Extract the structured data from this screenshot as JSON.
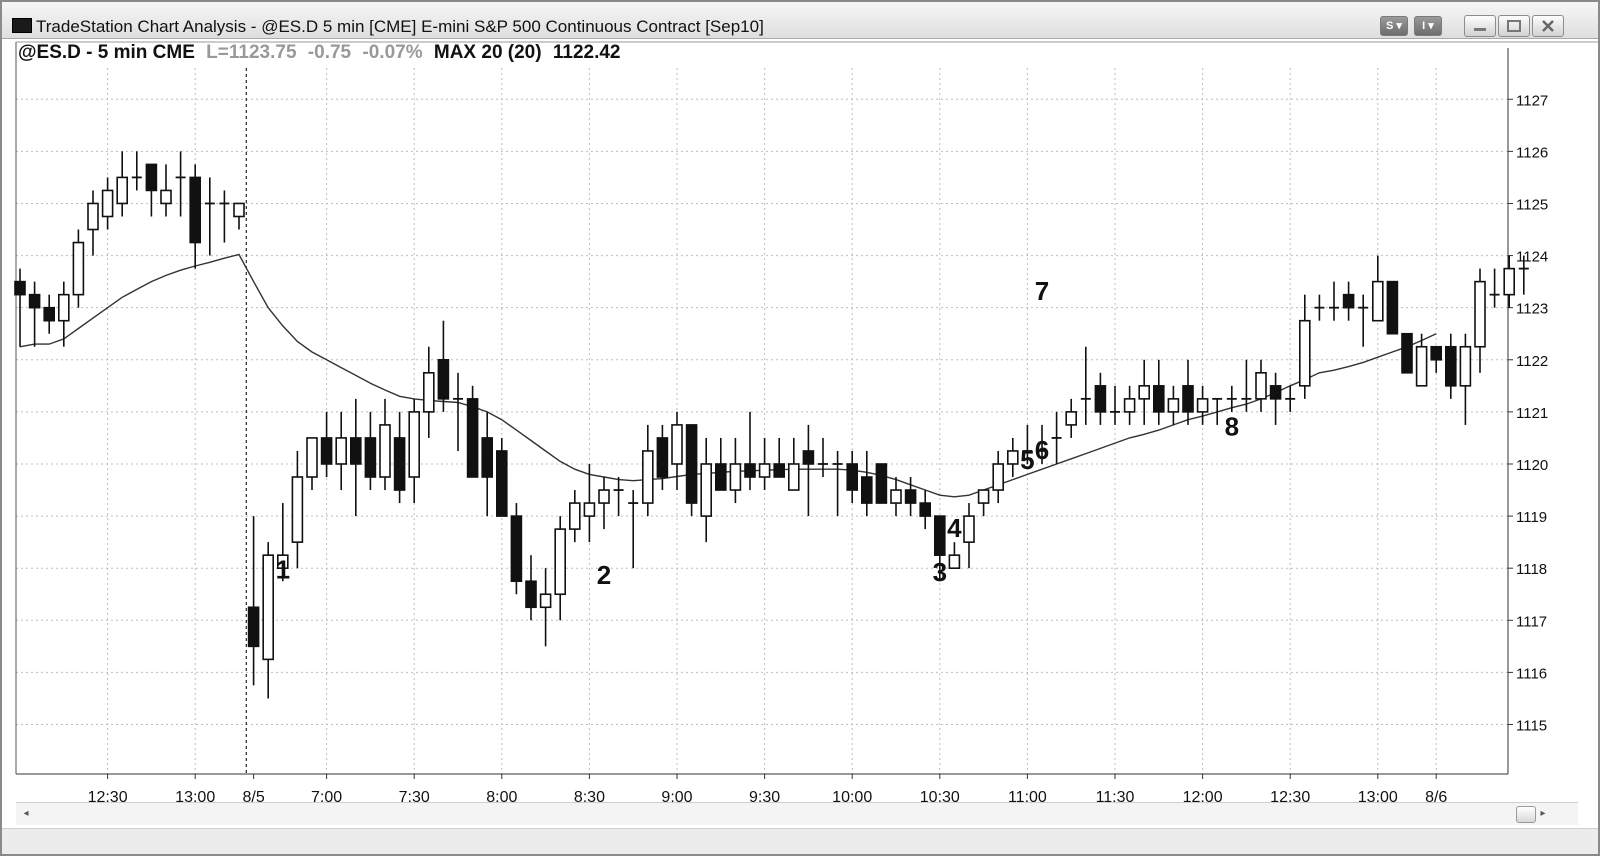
{
  "window": {
    "title": "TradeStation Chart Analysis - @ES.D 5 min [CME] E-mini S&P 500 Continuous Contract [Sep10]",
    "btn_s": "S",
    "btn_i": "I"
  },
  "header": {
    "symbol": "@ES.D - 5 min CME",
    "last": "L=1123.75",
    "change": "-0.75",
    "pct": "-0.07%",
    "study": "MAX 20 (20)",
    "study_value": "1122.42"
  },
  "colors": {
    "up_fill": "#ffffff",
    "down_fill": "#111111",
    "grid": "#bdbdbd",
    "ma_line": "#333333"
  },
  "chart_data": {
    "type": "candlestick",
    "ylim": [
      1114.05,
      1127.6
    ],
    "y_ticks": [
      1115,
      1116,
      1117,
      1118,
      1119,
      1120,
      1121,
      1122,
      1123,
      1124,
      1125,
      1126,
      1127
    ],
    "x_labels": [
      {
        "label": "12:30",
        "bar": 6
      },
      {
        "label": "13:00",
        "bar": 12
      },
      {
        "label": "8/5",
        "bar": 16
      },
      {
        "label": "7:00",
        "bar": 21
      },
      {
        "label": "7:30",
        "bar": 27
      },
      {
        "label": "8:00",
        "bar": 33
      },
      {
        "label": "8:30",
        "bar": 39
      },
      {
        "label": "9:00",
        "bar": 45
      },
      {
        "label": "9:30",
        "bar": 51
      },
      {
        "label": "10:00",
        "bar": 57
      },
      {
        "label": "10:30",
        "bar": 63
      },
      {
        "label": "11:00",
        "bar": 69
      },
      {
        "label": "11:30",
        "bar": 75
      },
      {
        "label": "12:00",
        "bar": 81
      },
      {
        "label": "12:30",
        "bar": 87
      },
      {
        "label": "13:00",
        "bar": 93
      },
      {
        "label": "8/6",
        "bar": 97
      }
    ],
    "session_break_bar": 16,
    "bars": [
      {
        "o": 1123.5,
        "h": 1123.75,
        "l": 1122.25,
        "c": 1123.25
      },
      {
        "o": 1123.25,
        "h": 1123.5,
        "l": 1122.25,
        "c": 1123.0
      },
      {
        "o": 1123.0,
        "h": 1123.25,
        "l": 1122.5,
        "c": 1122.75
      },
      {
        "o": 1122.75,
        "h": 1123.5,
        "l": 1122.25,
        "c": 1123.25
      },
      {
        "o": 1123.25,
        "h": 1124.5,
        "l": 1123.0,
        "c": 1124.25
      },
      {
        "o": 1124.5,
        "h": 1125.25,
        "l": 1124.0,
        "c": 1125.0
      },
      {
        "o": 1124.75,
        "h": 1125.5,
        "l": 1124.5,
        "c": 1125.25
      },
      {
        "o": 1125.0,
        "h": 1126.0,
        "l": 1124.75,
        "c": 1125.5
      },
      {
        "o": 1125.5,
        "h": 1126.0,
        "l": 1125.25,
        "c": 1125.5
      },
      {
        "o": 1125.75,
        "h": 1125.75,
        "l": 1124.75,
        "c": 1125.25
      },
      {
        "o": 1125.0,
        "h": 1125.75,
        "l": 1124.75,
        "c": 1125.25
      },
      {
        "o": 1125.5,
        "h": 1126.0,
        "l": 1124.75,
        "c": 1125.5
      },
      {
        "o": 1125.5,
        "h": 1125.75,
        "l": 1123.75,
        "c": 1124.25
      },
      {
        "o": 1125.0,
        "h": 1125.5,
        "l": 1124.0,
        "c": 1125.0
      },
      {
        "o": 1125.0,
        "h": 1125.25,
        "l": 1124.25,
        "c": 1125.0
      },
      {
        "o": 1124.75,
        "h": 1125.0,
        "l": 1124.5,
        "c": 1125.0
      },
      {
        "o": 1117.25,
        "h": 1119.0,
        "l": 1115.75,
        "c": 1116.5
      },
      {
        "o": 1116.25,
        "h": 1118.5,
        "l": 1115.5,
        "c": 1118.25
      },
      {
        "o": 1118.0,
        "h": 1119.25,
        "l": 1117.75,
        "c": 1118.25
      },
      {
        "o": 1118.5,
        "h": 1120.25,
        "l": 1118.0,
        "c": 1119.75
      },
      {
        "o": 1119.75,
        "h": 1120.5,
        "l": 1119.5,
        "c": 1120.5
      },
      {
        "o": 1120.5,
        "h": 1121.0,
        "l": 1119.75,
        "c": 1120.0
      },
      {
        "o": 1120.0,
        "h": 1121.0,
        "l": 1119.5,
        "c": 1120.5
      },
      {
        "o": 1120.5,
        "h": 1121.25,
        "l": 1119.0,
        "c": 1120.0
      },
      {
        "o": 1120.5,
        "h": 1121.0,
        "l": 1119.5,
        "c": 1119.75
      },
      {
        "o": 1119.75,
        "h": 1121.25,
        "l": 1119.5,
        "c": 1120.75
      },
      {
        "o": 1120.5,
        "h": 1121.0,
        "l": 1119.25,
        "c": 1119.5
      },
      {
        "o": 1119.75,
        "h": 1121.25,
        "l": 1119.25,
        "c": 1121.0
      },
      {
        "o": 1121.0,
        "h": 1122.25,
        "l": 1120.5,
        "c": 1121.75
      },
      {
        "o": 1122.0,
        "h": 1122.75,
        "l": 1121.0,
        "c": 1121.25
      },
      {
        "o": 1121.25,
        "h": 1121.75,
        "l": 1120.25,
        "c": 1121.25
      },
      {
        "o": 1121.25,
        "h": 1121.5,
        "l": 1119.75,
        "c": 1119.75
      },
      {
        "o": 1120.5,
        "h": 1121.0,
        "l": 1119.0,
        "c": 1119.75
      },
      {
        "o": 1120.25,
        "h": 1120.5,
        "l": 1119.0,
        "c": 1119.0
      },
      {
        "o": 1119.0,
        "h": 1119.25,
        "l": 1117.5,
        "c": 1117.75
      },
      {
        "o": 1117.75,
        "h": 1118.25,
        "l": 1117.0,
        "c": 1117.25
      },
      {
        "o": 1117.25,
        "h": 1118.0,
        "l": 1116.5,
        "c": 1117.5
      },
      {
        "o": 1117.5,
        "h": 1119.0,
        "l": 1117.0,
        "c": 1118.75
      },
      {
        "o": 1118.75,
        "h": 1119.5,
        "l": 1118.5,
        "c": 1119.25
      },
      {
        "o": 1119.0,
        "h": 1120.0,
        "l": 1118.5,
        "c": 1119.25
      },
      {
        "o": 1119.25,
        "h": 1119.75,
        "l": 1118.75,
        "c": 1119.5
      },
      {
        "o": 1119.5,
        "h": 1119.75,
        "l": 1119.0,
        "c": 1119.5
      },
      {
        "o": 1119.25,
        "h": 1119.5,
        "l": 1118.0,
        "c": 1119.25
      },
      {
        "o": 1119.25,
        "h": 1120.75,
        "l": 1119.0,
        "c": 1120.25
      },
      {
        "o": 1120.5,
        "h": 1120.75,
        "l": 1119.5,
        "c": 1119.75
      },
      {
        "o": 1120.0,
        "h": 1121.0,
        "l": 1119.5,
        "c": 1120.75
      },
      {
        "o": 1120.75,
        "h": 1120.75,
        "l": 1119.0,
        "c": 1119.25
      },
      {
        "o": 1119.0,
        "h": 1120.5,
        "l": 1118.5,
        "c": 1120.0
      },
      {
        "o": 1120.0,
        "h": 1120.5,
        "l": 1119.5,
        "c": 1119.5
      },
      {
        "o": 1119.5,
        "h": 1120.5,
        "l": 1119.25,
        "c": 1120.0
      },
      {
        "o": 1120.0,
        "h": 1121.0,
        "l": 1119.5,
        "c": 1119.75
      },
      {
        "o": 1119.75,
        "h": 1120.5,
        "l": 1119.5,
        "c": 1120.0
      },
      {
        "o": 1120.0,
        "h": 1120.5,
        "l": 1119.75,
        "c": 1119.75
      },
      {
        "o": 1119.5,
        "h": 1120.5,
        "l": 1119.5,
        "c": 1120.0
      },
      {
        "o": 1120.25,
        "h": 1120.75,
        "l": 1119.0,
        "c": 1120.0
      },
      {
        "o": 1120.0,
        "h": 1120.5,
        "l": 1119.75,
        "c": 1120.0
      },
      {
        "o": 1120.0,
        "h": 1120.25,
        "l": 1119.0,
        "c": 1120.0
      },
      {
        "o": 1120.0,
        "h": 1120.25,
        "l": 1119.25,
        "c": 1119.5
      },
      {
        "o": 1119.75,
        "h": 1120.25,
        "l": 1119.0,
        "c": 1119.25
      },
      {
        "o": 1120.0,
        "h": 1120.0,
        "l": 1119.25,
        "c": 1119.25
      },
      {
        "o": 1119.25,
        "h": 1119.75,
        "l": 1119.0,
        "c": 1119.5
      },
      {
        "o": 1119.5,
        "h": 1119.75,
        "l": 1119.0,
        "c": 1119.25
      },
      {
        "o": 1119.25,
        "h": 1119.5,
        "l": 1118.75,
        "c": 1119.0
      },
      {
        "o": 1119.0,
        "h": 1119.0,
        "l": 1117.75,
        "c": 1118.25
      },
      {
        "o": 1118.0,
        "h": 1118.5,
        "l": 1118.0,
        "c": 1118.25
      },
      {
        "o": 1118.5,
        "h": 1119.25,
        "l": 1118.0,
        "c": 1119.0
      },
      {
        "o": 1119.25,
        "h": 1119.5,
        "l": 1119.0,
        "c": 1119.5
      },
      {
        "o": 1119.5,
        "h": 1120.25,
        "l": 1119.25,
        "c": 1120.0
      },
      {
        "o": 1120.0,
        "h": 1120.5,
        "l": 1119.75,
        "c": 1120.25
      },
      {
        "o": 1120.25,
        "h": 1120.75,
        "l": 1120.0,
        "c": 1120.25
      },
      {
        "o": 1120.25,
        "h": 1120.75,
        "l": 1120.0,
        "c": 1120.25
      },
      {
        "o": 1120.5,
        "h": 1121.0,
        "l": 1120.0,
        "c": 1120.5
      },
      {
        "o": 1120.75,
        "h": 1121.25,
        "l": 1120.5,
        "c": 1121.0
      },
      {
        "o": 1121.25,
        "h": 1122.25,
        "l": 1120.75,
        "c": 1121.25
      },
      {
        "o": 1121.5,
        "h": 1121.75,
        "l": 1120.75,
        "c": 1121.0
      },
      {
        "o": 1121.0,
        "h": 1121.5,
        "l": 1120.75,
        "c": 1121.0
      },
      {
        "o": 1121.0,
        "h": 1121.5,
        "l": 1120.75,
        "c": 1121.25
      },
      {
        "o": 1121.25,
        "h": 1122.0,
        "l": 1120.75,
        "c": 1121.5
      },
      {
        "o": 1121.5,
        "h": 1122.0,
        "l": 1120.75,
        "c": 1121.0
      },
      {
        "o": 1121.0,
        "h": 1121.5,
        "l": 1120.75,
        "c": 1121.25
      },
      {
        "o": 1121.5,
        "h": 1122.0,
        "l": 1120.75,
        "c": 1121.0
      },
      {
        "o": 1121.0,
        "h": 1121.5,
        "l": 1120.75,
        "c": 1121.25
      },
      {
        "o": 1121.25,
        "h": 1121.25,
        "l": 1120.75,
        "c": 1121.25
      },
      {
        "o": 1121.25,
        "h": 1121.5,
        "l": 1121.0,
        "c": 1121.25
      },
      {
        "o": 1121.25,
        "h": 1122.0,
        "l": 1121.0,
        "c": 1121.25
      },
      {
        "o": 1121.25,
        "h": 1122.0,
        "l": 1121.0,
        "c": 1121.75
      },
      {
        "o": 1121.5,
        "h": 1121.75,
        "l": 1120.75,
        "c": 1121.25
      },
      {
        "o": 1121.25,
        "h": 1121.5,
        "l": 1121.0,
        "c": 1121.25
      },
      {
        "o": 1121.5,
        "h": 1123.25,
        "l": 1121.25,
        "c": 1122.75
      },
      {
        "o": 1123.0,
        "h": 1123.25,
        "l": 1122.75,
        "c": 1123.0
      },
      {
        "o": 1123.0,
        "h": 1123.5,
        "l": 1122.75,
        "c": 1123.0
      },
      {
        "o": 1123.25,
        "h": 1123.5,
        "l": 1122.75,
        "c": 1123.0
      },
      {
        "o": 1123.0,
        "h": 1123.25,
        "l": 1122.25,
        "c": 1123.0
      },
      {
        "o": 1122.75,
        "h": 1124.0,
        "l": 1122.75,
        "c": 1123.5
      },
      {
        "o": 1123.5,
        "h": 1123.5,
        "l": 1122.5,
        "c": 1122.5
      },
      {
        "o": 1122.5,
        "h": 1122.5,
        "l": 1121.75,
        "c": 1121.75
      },
      {
        "o": 1121.5,
        "h": 1122.5,
        "l": 1121.5,
        "c": 1122.25
      },
      {
        "o": 1122.25,
        "h": 1122.25,
        "l": 1121.75,
        "c": 1122.0
      },
      {
        "o": 1122.25,
        "h": 1122.5,
        "l": 1121.25,
        "c": 1121.5
      },
      {
        "o": 1121.5,
        "h": 1122.5,
        "l": 1120.75,
        "c": 1122.25
      },
      {
        "o": 1122.25,
        "h": 1123.75,
        "l": 1121.75,
        "c": 1123.5
      },
      {
        "o": 1123.25,
        "h": 1123.75,
        "l": 1123.0,
        "c": 1123.25
      },
      {
        "o": 1123.25,
        "h": 1124.0,
        "l": 1123.0,
        "c": 1123.75
      },
      {
        "o": 1123.75,
        "h": 1124.0,
        "l": 1123.25,
        "c": 1123.75
      }
    ],
    "ma": [
      1122.25,
      1122.3,
      1122.3,
      1122.4,
      1122.6,
      1122.8,
      1123.0,
      1123.2,
      1123.35,
      1123.5,
      1123.62,
      1123.72,
      1123.8,
      1123.87,
      1123.95,
      1124.02,
      1123.5,
      1123.0,
      1122.65,
      1122.35,
      1122.15,
      1122.0,
      1121.85,
      1121.7,
      1121.55,
      1121.42,
      1121.3,
      1121.25,
      1121.22,
      1121.2,
      1121.18,
      1121.1,
      1121.0,
      1120.85,
      1120.65,
      1120.45,
      1120.25,
      1120.05,
      1119.9,
      1119.8,
      1119.75,
      1119.7,
      1119.68,
      1119.7,
      1119.72,
      1119.76,
      1119.8,
      1119.82,
      1119.84,
      1119.86,
      1119.87,
      1119.88,
      1119.89,
      1119.9,
      1119.9,
      1119.9,
      1119.9,
      1119.88,
      1119.84,
      1119.78,
      1119.7,
      1119.6,
      1119.5,
      1119.4,
      1119.37,
      1119.4,
      1119.5,
      1119.6,
      1119.7,
      1119.8,
      1119.9,
      1120.0,
      1120.1,
      1120.2,
      1120.3,
      1120.4,
      1120.5,
      1120.57,
      1120.65,
      1120.75,
      1120.85,
      1120.92,
      1121.0,
      1121.08,
      1121.15,
      1121.25,
      1121.37,
      1121.5,
      1121.62,
      1121.75,
      1121.8,
      1121.87,
      1121.95,
      1122.05,
      1122.15,
      1122.25,
      1122.37,
      1122.5
    ],
    "annotations": [
      {
        "text": "1",
        "bar": 18,
        "price": 1117.8
      },
      {
        "text": "2",
        "bar": 40,
        "price": 1117.7
      },
      {
        "text": "3",
        "bar": 63,
        "price": 1117.75
      },
      {
        "text": "4",
        "bar": 64,
        "price": 1118.6
      },
      {
        "text": "5",
        "bar": 69,
        "price": 1119.9
      },
      {
        "text": "6",
        "bar": 70,
        "price": 1120.1
      },
      {
        "text": "7",
        "bar": 70,
        "price": 1123.15
      },
      {
        "text": "8",
        "bar": 83,
        "price": 1120.55
      }
    ]
  }
}
